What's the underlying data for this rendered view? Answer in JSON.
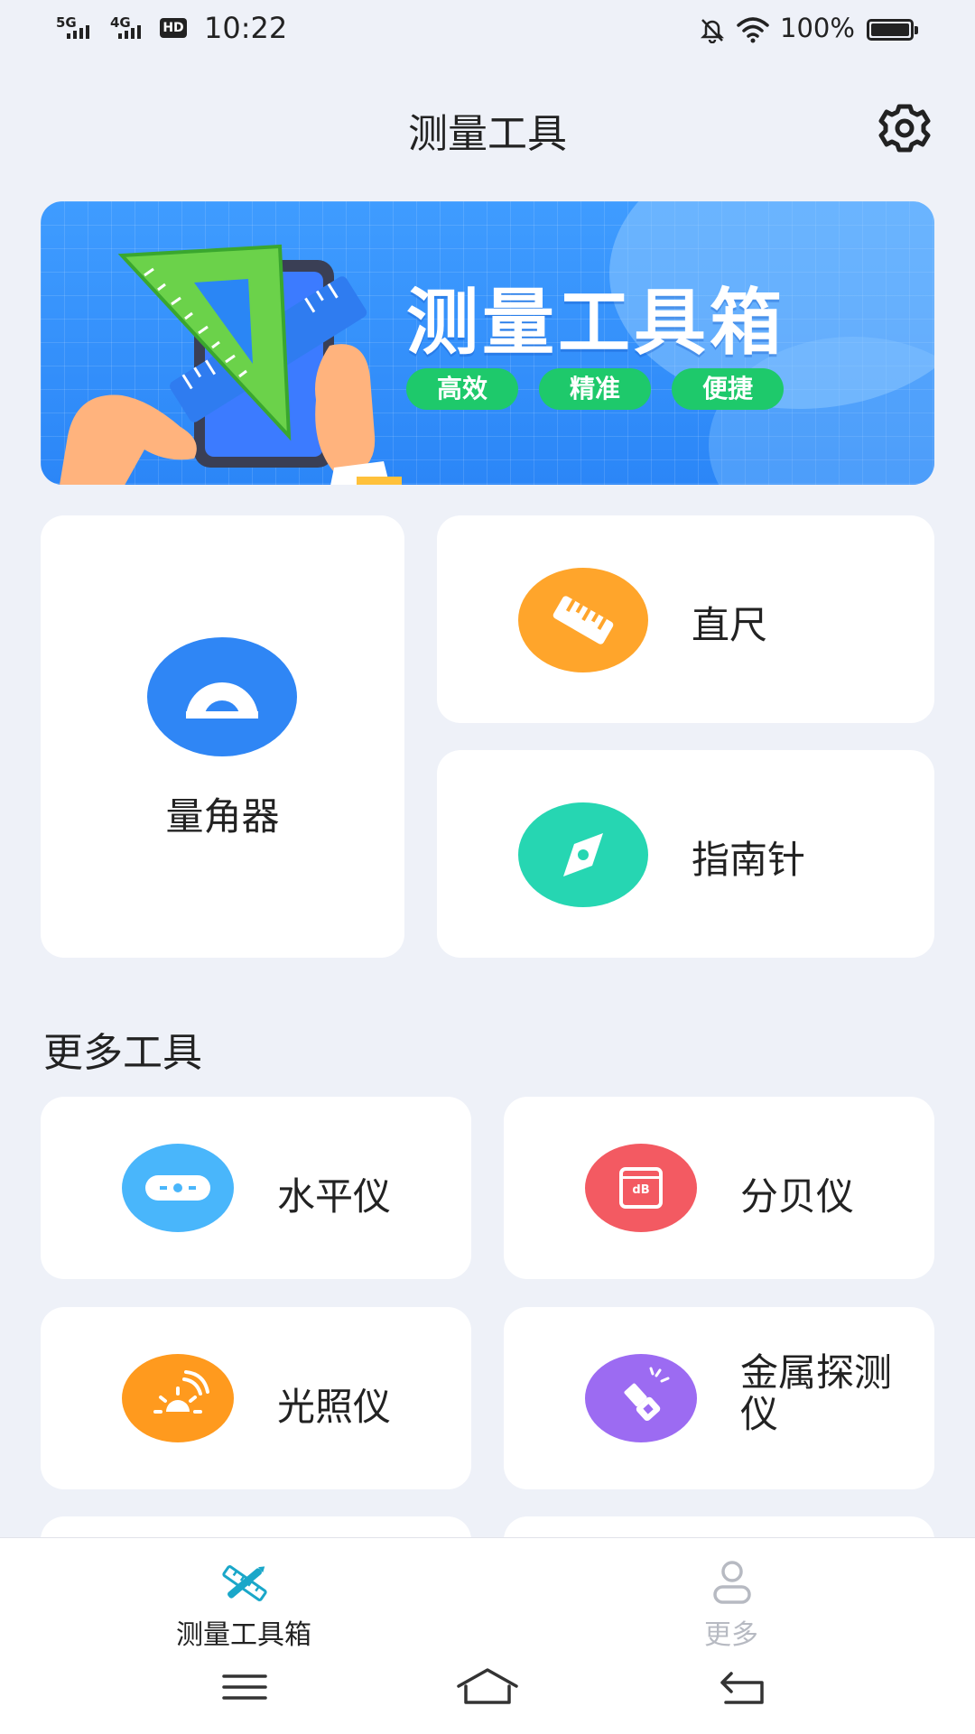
{
  "status_bar": {
    "signal1": "5G",
    "signal2": "4G",
    "hd": "HD",
    "time": "10:22",
    "battery_pct": "100%",
    "battery_level": 1.0
  },
  "header": {
    "title": "测量工具"
  },
  "banner": {
    "title": "测量工具箱",
    "tags": [
      "高效",
      "精准",
      "便捷"
    ]
  },
  "tools": {
    "protractor": "量角器",
    "ruler": "直尺",
    "compass": "指南针"
  },
  "more_tools": {
    "section_title": "更多工具",
    "items": [
      "水平仪",
      "分贝仪",
      "光照仪",
      "金属探测仪"
    ],
    "db_icon_text": "dB"
  },
  "bottom_nav": {
    "items": [
      "测量工具箱",
      "更多"
    ],
    "active": 0
  },
  "colors": {
    "background": "#eef1f8",
    "protractor": "#2f86f5",
    "ruler": "#ffa52b",
    "compass": "#26d6b2",
    "level": "#49b6fb",
    "decibel": "#f35a62",
    "light": "#ff9a1e",
    "metal": "#9c6bf2",
    "nav_active": "#1aa7c9"
  }
}
